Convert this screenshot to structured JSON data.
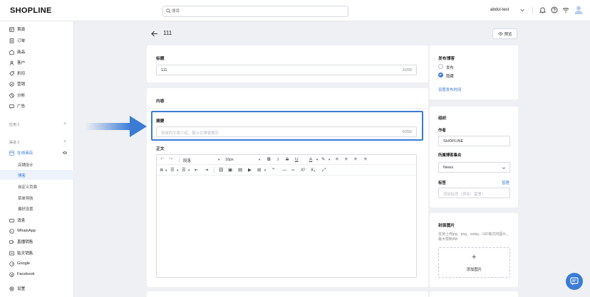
{
  "header": {
    "logo": "SHOPLINE",
    "search_placeholder": "搜尋",
    "user": "abdul-test"
  },
  "sidebar": {
    "top_items": [
      {
        "label": "首頁",
        "icon": "home-icon"
      },
      {
        "label": "订单",
        "icon": "order-icon"
      },
      {
        "label": "商品",
        "icon": "product-icon"
      },
      {
        "label": "客户",
        "icon": "customer-icon"
      },
      {
        "label": "折扣",
        "icon": "discount-icon"
      },
      {
        "label": "营销",
        "icon": "marketing-icon"
      },
      {
        "label": "分析",
        "icon": "analytics-icon"
      },
      {
        "label": "广告",
        "icon": "ads-icon"
      }
    ],
    "section1_label": "应用 3",
    "section2_label": "渠道 3",
    "online_store": "在线商店",
    "store_subitems": [
      "店铺设计",
      "博客",
      "自定义页面",
      "菜单导航",
      "偏好设置"
    ],
    "active_subitem": "博客",
    "channel_items": [
      {
        "label": "消息",
        "icon": "message-icon"
      },
      {
        "label": "WhatsApp",
        "icon": "whatsapp-icon"
      },
      {
        "label": "直播销售",
        "icon": "live-icon"
      },
      {
        "label": "贴文销售",
        "icon": "post-icon"
      },
      {
        "label": "Google",
        "icon": "google-icon"
      },
      {
        "label": "Facebook",
        "icon": "facebook-icon"
      }
    ],
    "settings": "设置"
  },
  "page": {
    "title": "111",
    "preview": "预览"
  },
  "form": {
    "title_label": "标题",
    "title_value": "111",
    "title_count": "3/255",
    "content_label": "内容",
    "summary_label": "摘要",
    "summary_placeholder": "简单的文章介绍，展示在博客首页",
    "summary_count": "0/255",
    "body_label": "正文",
    "paragraph_option": "段落",
    "fontsize_option": "16px"
  },
  "publish": {
    "title": "发布博客",
    "option_publish": "发布",
    "option_hidden": "隐藏",
    "selected": "hidden",
    "schedule_link": "设置发布时间"
  },
  "org": {
    "title": "组织",
    "author_label": "作者",
    "author_value": "SHOPLINE",
    "collection_label": "所属博客集合",
    "collection_value": "News",
    "tags_label": "标签",
    "tags_manage": "管理",
    "tags_placeholder": "添加标签（例如：夏季）"
  },
  "cover": {
    "title": "封面图片",
    "hint": "支持上传jpg、png、webp、GIF格式的图片，最大限制4M",
    "add_text": "添加图片"
  },
  "colors": {
    "accent": "#3a7bd5",
    "background": "#eef0f3",
    "active_nav": "#edf2fb"
  }
}
